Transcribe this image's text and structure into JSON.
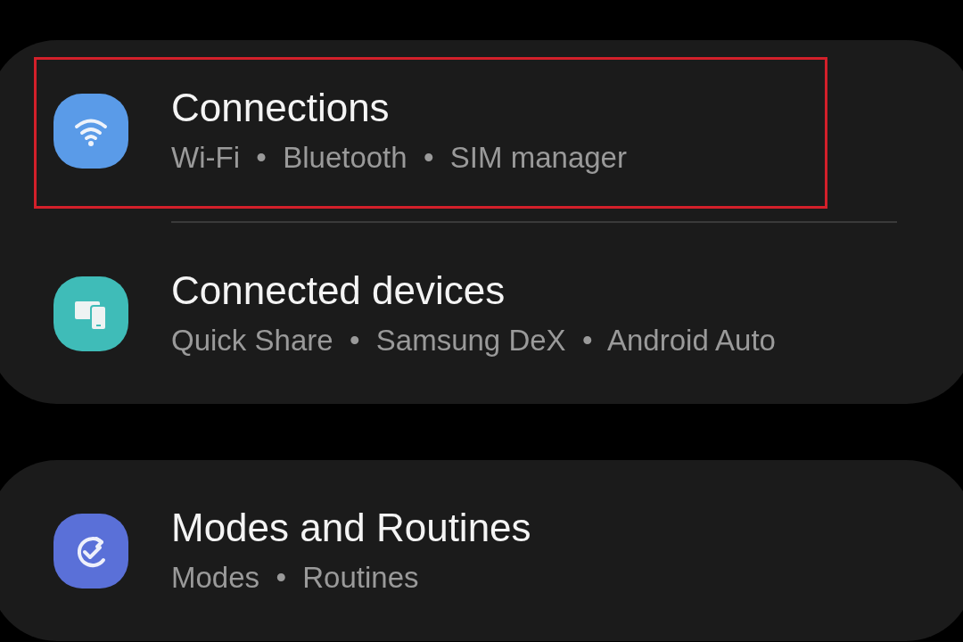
{
  "cards": [
    {
      "items": [
        {
          "kind": "wifi",
          "color": "#5a9be8",
          "title": "Connections",
          "subtitle": "Wi-Fi  •  Bluetooth  •  SIM manager",
          "highlighted": true
        },
        {
          "kind": "devices",
          "color": "#3fbcb8",
          "title": "Connected devices",
          "subtitle": "Quick Share  •  Samsung DeX  •  Android Auto",
          "highlighted": false
        }
      ]
    },
    {
      "items": [
        {
          "kind": "routines",
          "color": "#5a70d8",
          "title": "Modes and Routines",
          "subtitle": "Modes  •  Routines",
          "highlighted": false
        }
      ]
    }
  ]
}
